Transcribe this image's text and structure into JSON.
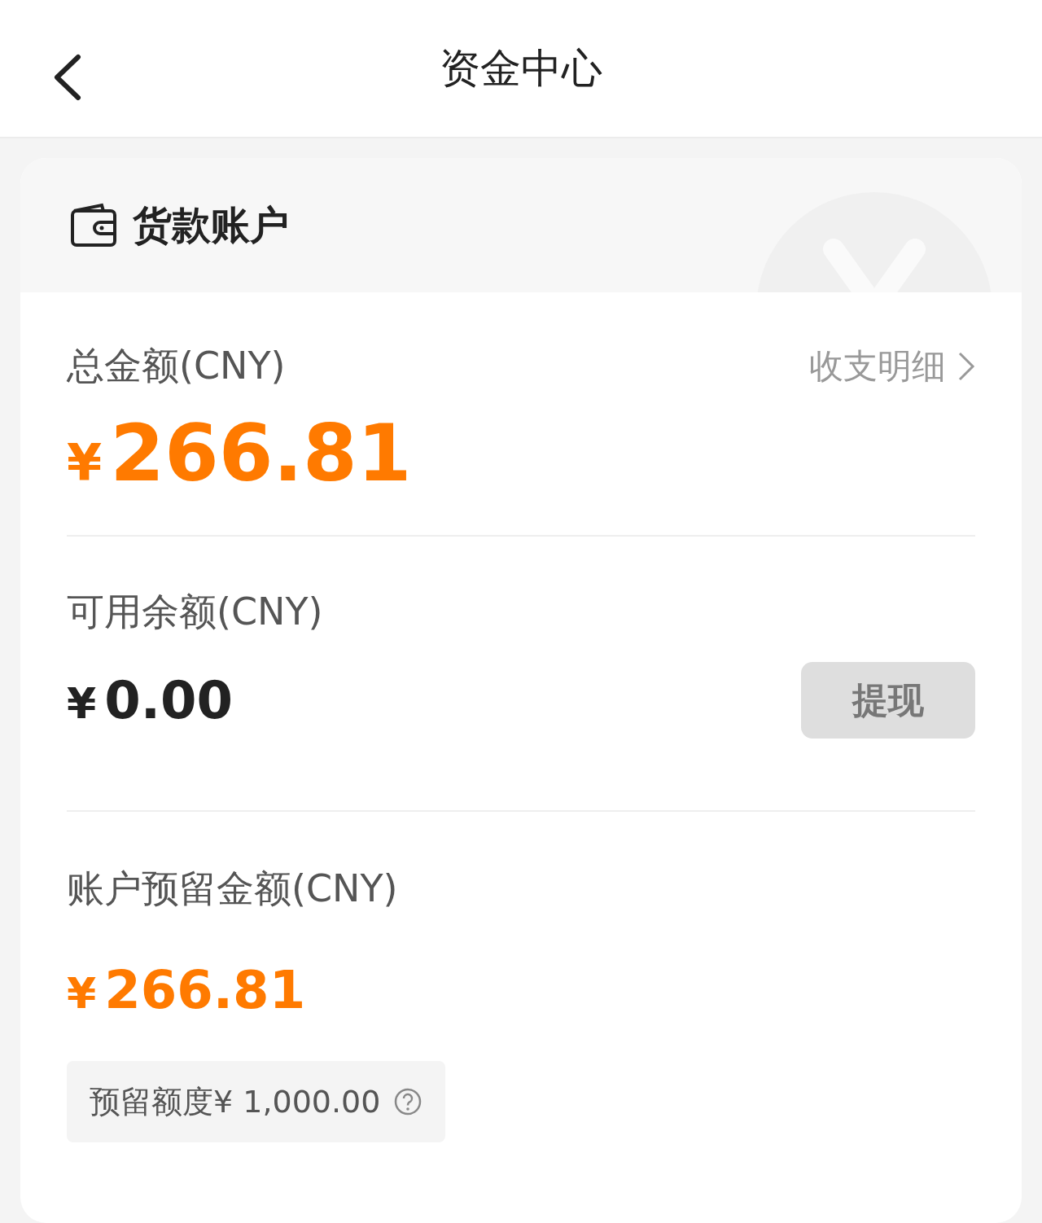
{
  "header": {
    "title": "资金中心"
  },
  "account": {
    "title": "货款账户"
  },
  "total": {
    "label": "总金额(CNY)",
    "link": "收支明细",
    "currency": "¥",
    "amount": "266.81"
  },
  "available": {
    "label": "可用余额(CNY)",
    "currency": "¥",
    "amount": "0.00",
    "button": {
      "label": "提现",
      "disabled": true
    }
  },
  "reserved": {
    "label": "账户预留金额(CNY)",
    "currency": "¥",
    "amount": "266.81",
    "quota": "预留额度¥ 1,000.00"
  }
}
